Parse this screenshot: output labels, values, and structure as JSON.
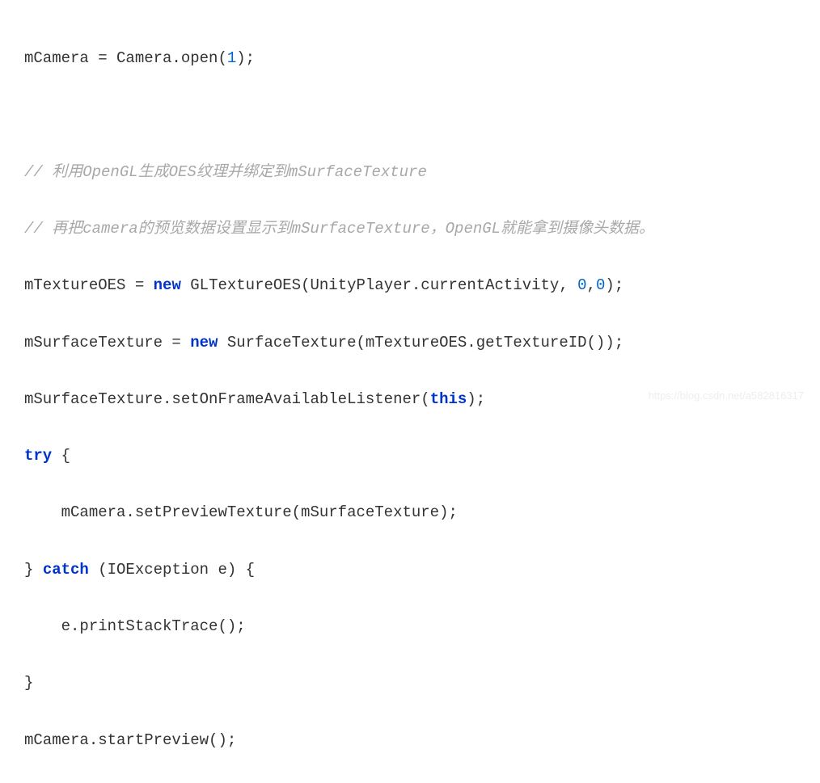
{
  "code": {
    "line1": {
      "text1": "mCamera = Camera.open(",
      "num": "1",
      "text2": ");"
    },
    "line2": "",
    "line3": {
      "comment": "// 利用OpenGL生成OES纹理并绑定到mSurfaceTexture"
    },
    "line4": {
      "comment": "// 再把camera的预览数据设置显示到mSurfaceTexture，OpenGL就能拿到摄像头数据。"
    },
    "line5": {
      "text1": "mTextureOES = ",
      "kw": "new",
      "text2": " GLTextureOES(UnityPlayer.currentActivity, ",
      "num1": "0",
      "comma": ",",
      "num2": "0",
      "text3": ");"
    },
    "line6": {
      "text1": "mSurfaceTexture = ",
      "kw": "new",
      "text2": " SurfaceTexture(mTextureOES.getTextureID());"
    },
    "line7": {
      "text1": "mSurfaceTexture.setOnFrameAvailableListener(",
      "kw": "this",
      "text2": ");"
    },
    "line8": {
      "kw": "try",
      "text": " {"
    },
    "line9": {
      "indent": "    ",
      "text": "mCamera.setPreviewTexture(mSurfaceTexture);"
    },
    "line10": {
      "text1": "} ",
      "kw": "catch",
      "text2": " (IOException e) {"
    },
    "line11": {
      "indent": "    ",
      "text": "e.printStackTrace();"
    },
    "line12": {
      "text": "}"
    },
    "line13": {
      "text": "mCamera.startPreview();"
    }
  },
  "watermark": "https://blog.csdn.net/a582816317"
}
